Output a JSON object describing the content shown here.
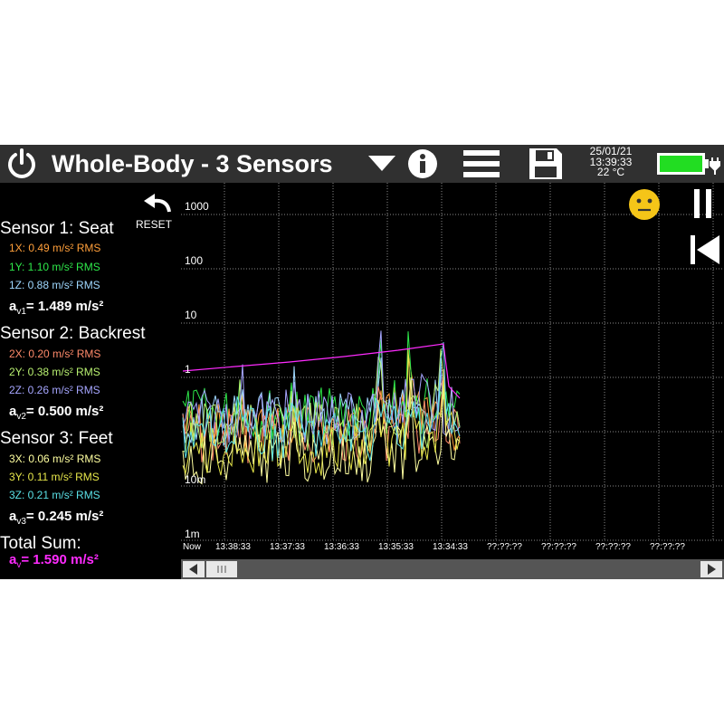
{
  "header": {
    "title": "Whole-Body - 3 Sensors",
    "date": "25/01/21",
    "time": "13:39:33",
    "temperature": "22 °C",
    "icons": [
      "power-icon",
      "dropdown-icon",
      "info-icon",
      "menu-icon",
      "save-icon",
      "battery-icon"
    ]
  },
  "left_panel": {
    "reset_label": "RESET",
    "sensors": [
      {
        "title": "Sensor 1: Seat",
        "axes": [
          {
            "label": "1X: 0.49 m/s² RMS",
            "color": "#ff9f3a"
          },
          {
            "label": "1Y: 1.10 m/s² RMS",
            "color": "#2ee84a"
          },
          {
            "label": "1Z: 0.88 m/s² RMS",
            "color": "#9fd8ff"
          }
        ],
        "av_label": "a",
        "av_sub": "v1",
        "av_value": "= 1.489 m/s²"
      },
      {
        "title": "Sensor 2: Backrest",
        "axes": [
          {
            "label": "2X: 0.20 m/s² RMS",
            "color": "#ff8a6a"
          },
          {
            "label": "2Y: 0.38 m/s² RMS",
            "color": "#b8f070"
          },
          {
            "label": "2Z: 0.26 m/s² RMS",
            "color": "#a6a6ff"
          }
        ],
        "av_label": "a",
        "av_sub": "v2",
        "av_value": "= 0.500 m/s²"
      },
      {
        "title": "Sensor 3: Feet",
        "axes": [
          {
            "label": "3X: 0.06 m/s² RMS",
            "color": "#ffffa0"
          },
          {
            "label": "3Y: 0.11 m/s² RMS",
            "color": "#e6e64a"
          },
          {
            "label": "3Z: 0.21 m/s² RMS",
            "color": "#5ae0e6"
          }
        ],
        "av_label": "a",
        "av_sub": "v3",
        "av_value": "= 0.245 m/s²"
      }
    ],
    "total": {
      "title": "Total Sum:",
      "av_label": "a",
      "av_sub": "v",
      "av_value": "= 1.590 m/s²",
      "color": "#ff2bff"
    }
  },
  "chart_data": {
    "type": "line",
    "yscale": "log",
    "ytick_labels": [
      "1000",
      "100",
      "10",
      "1",
      "10m",
      "1m"
    ],
    "xtick_labels": [
      "Now",
      "13:38:33",
      "13:37:33",
      "13:36:33",
      "13:35:33",
      "13:34:33",
      "??:??:??",
      "??:??:??",
      "??:??:??",
      "??:??:??"
    ],
    "grid": true
  },
  "colors": {
    "background": "#000000",
    "titlebar": "#303030",
    "battery": "#22dd22",
    "status_face": "#f5c518"
  }
}
